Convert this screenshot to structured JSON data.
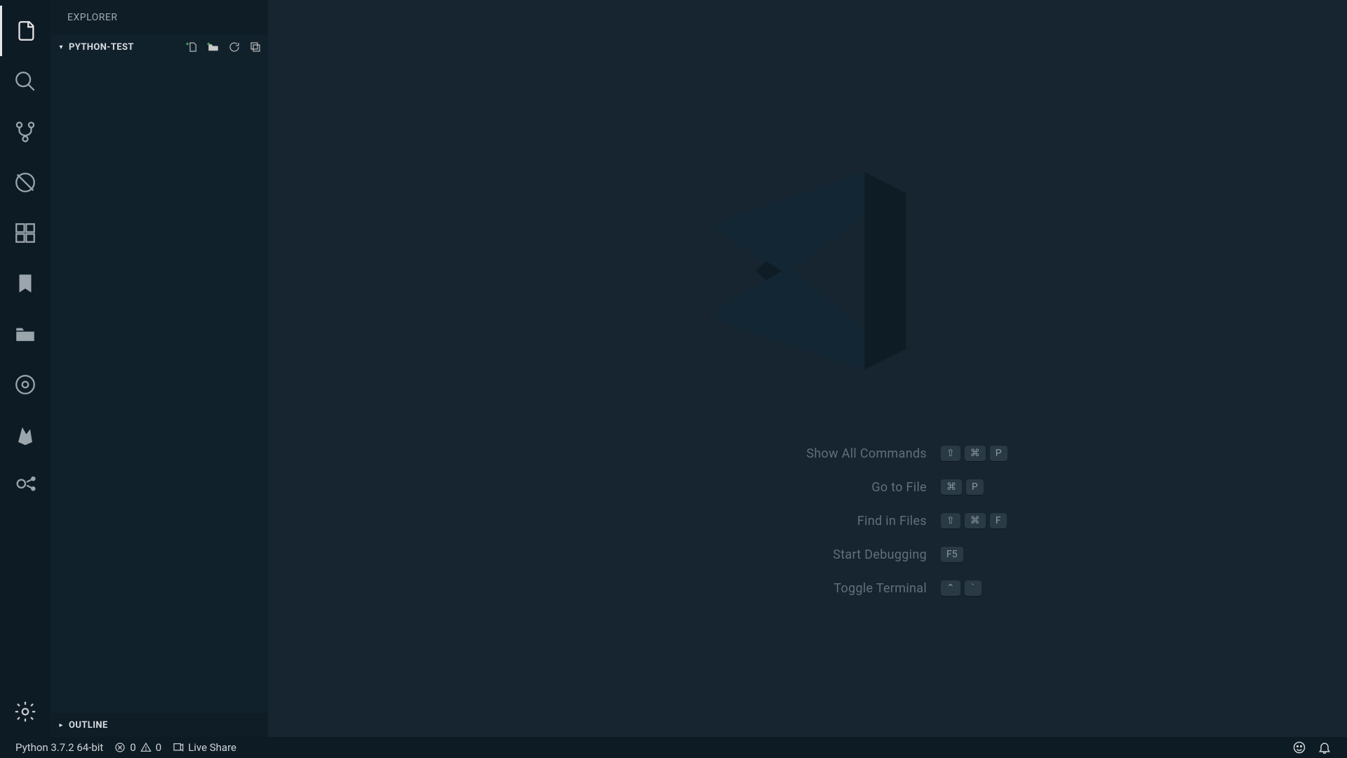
{
  "sidebar": {
    "title": "EXPLORER",
    "folder": "PYTHON-TEST",
    "outline": "OUTLINE"
  },
  "welcome": {
    "commands": [
      {
        "label": "Show All Commands",
        "keys": [
          "⇧",
          "⌘",
          "P"
        ]
      },
      {
        "label": "Go to File",
        "keys": [
          "⌘",
          "P"
        ]
      },
      {
        "label": "Find in Files",
        "keys": [
          "⇧",
          "⌘",
          "F"
        ]
      },
      {
        "label": "Start Debugging",
        "keys": [
          "F5"
        ]
      },
      {
        "label": "Toggle Terminal",
        "keys": [
          "⌃",
          "`"
        ]
      }
    ]
  },
  "status": {
    "python": "Python 3.7.2 64-bit",
    "errors": "0",
    "warnings": "0",
    "liveshare": "Live Share"
  },
  "activity": {
    "items": [
      "explorer",
      "search",
      "source-control",
      "debug",
      "extensions",
      "bookmarks",
      "project-manager",
      "git-graph",
      "firebase",
      "live-share"
    ]
  }
}
